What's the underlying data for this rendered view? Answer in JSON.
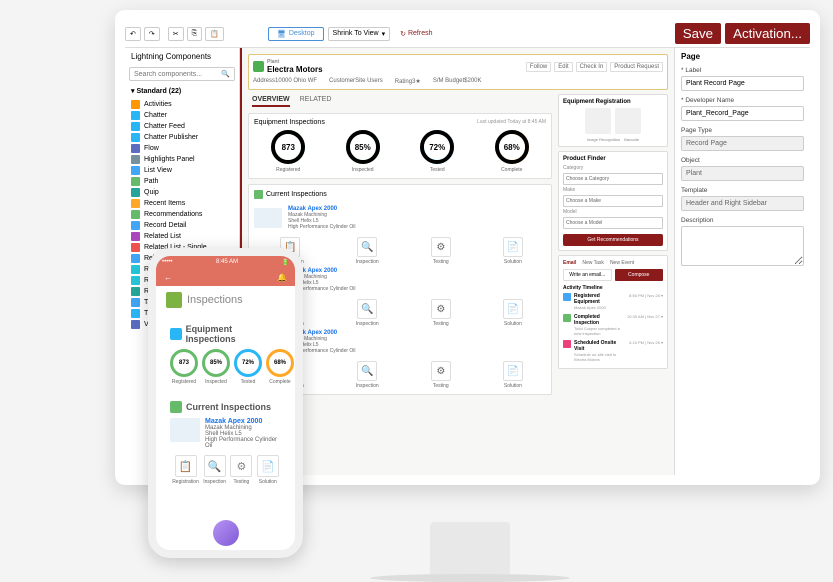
{
  "toolbar": {
    "undo": "↶",
    "desktop": "Desktop",
    "shrink": "Shrink To View",
    "refresh": "Refresh",
    "save": "Save",
    "activation": "Activation..."
  },
  "sidebar": {
    "title": "Lightning Components",
    "search_placeholder": "Search components...",
    "standard_header": "Standard (22)",
    "items": [
      {
        "label": "Activities",
        "color": "#ff9800"
      },
      {
        "label": "Chatter",
        "color": "#29b6f6"
      },
      {
        "label": "Chatter Feed",
        "color": "#29b6f6"
      },
      {
        "label": "Chatter Publisher",
        "color": "#29b6f6"
      },
      {
        "label": "Flow",
        "color": "#5c6bc0"
      },
      {
        "label": "Highlights Panel",
        "color": "#78909c"
      },
      {
        "label": "List View",
        "color": "#42a5f5"
      },
      {
        "label": "Path",
        "color": "#66bb6a"
      },
      {
        "label": "Quip",
        "color": "#26a69a"
      },
      {
        "label": "Recent Items",
        "color": "#ffa726"
      },
      {
        "label": "Recommendations",
        "color": "#66bb6a"
      },
      {
        "label": "Record Detail",
        "color": "#42a5f5"
      },
      {
        "label": "Related List",
        "color": "#ab47bc"
      },
      {
        "label": "Related List - Single",
        "color": "#ef5350"
      },
      {
        "label": "Related Lists",
        "color": "#42a5f5"
      },
      {
        "label": "Related Record",
        "color": "#26c6da"
      },
      {
        "label": "Report Chart",
        "color": "#26c6da"
      },
      {
        "label": "Rich Text",
        "color": "#26a69a"
      },
      {
        "label": "Tabs",
        "color": "#42a5f5"
      },
      {
        "label": "Trending Topics",
        "color": "#29b6f6"
      },
      {
        "label": "Visualforce",
        "color": "#5c6bc0"
      }
    ]
  },
  "page": {
    "type_label": "Plant",
    "title": "Electra Motors",
    "actions": [
      "Follow",
      "Edit",
      "Check In",
      "Product Request"
    ],
    "fields": [
      {
        "label": "Address",
        "value": "10000 Ohio WF"
      },
      {
        "label": "Customer",
        "value": "Site Users"
      },
      {
        "label": "Rating",
        "value": "3★"
      },
      {
        "label": "S/M Budget",
        "value": "$200K"
      }
    ]
  },
  "tabs": [
    "OVERVIEW",
    "RELATED"
  ],
  "equipment_inspections": {
    "title": "Equipment Inspections",
    "updated": "Last updated Today at 8:45 AM",
    "metrics": [
      {
        "value": "873",
        "label": "Registered",
        "color": "#66bb6a"
      },
      {
        "value": "85%",
        "label": "Inspected",
        "color": "#66bb6a"
      },
      {
        "value": "72%",
        "label": "Tested",
        "color": "#29b6f6"
      },
      {
        "value": "68%",
        "label": "Complete",
        "color": "#ffa726"
      }
    ]
  },
  "current_inspections": {
    "title": "Current Inspections",
    "items": [
      {
        "name": "Mazak Apex 2000",
        "sub1": "Mazak Machining",
        "sub2": "Shell Helix L5",
        "sub3": "High Performance Cylinder Oil"
      }
    ],
    "actions": [
      {
        "icon": "📋",
        "label": "Registration"
      },
      {
        "icon": "🔍",
        "label": "Inspection"
      },
      {
        "icon": "⚙",
        "label": "Testing"
      },
      {
        "icon": "📄",
        "label": "Solution"
      }
    ]
  },
  "equipment_registration": {
    "title": "Equipment Registration",
    "img1_label": "Image Recognition",
    "img2_label": "Barcode"
  },
  "product_finder": {
    "title": "Product Finder",
    "category_label": "Category",
    "category_select": "Choose a Category",
    "make_label": "Make",
    "make_select": "Choose a Make",
    "model_label": "Model",
    "model_select": "Choose a Model",
    "button": "Get Recommendations"
  },
  "activity": {
    "tabs": [
      "Email",
      "New Task",
      "New Event"
    ],
    "write_btn": "Write an email...",
    "compose_btn": "Compose",
    "timeline_title": "Activity Timeline",
    "items": [
      {
        "title": "Registered Equipment",
        "sub": "Mazak Apex 2000",
        "time": "8:56 PM | Nov 28",
        "color": "#42a5f5"
      },
      {
        "title": "Completed Inspection",
        "sub": "Todd Cooper completed a new inspection",
        "time": "10:30 AM | Nov 27",
        "color": "#66bb6a"
      },
      {
        "title": "Scheduled Onsite Visit",
        "sub": "Schedule on-site visit to Electra Motors",
        "time": "3:15 PM | Nov 26",
        "color": "#ec407a"
      }
    ]
  },
  "properties": {
    "title": "Page",
    "label_label": "* Label",
    "label_value": "Plant Record Page",
    "devname_label": "* Developer Name",
    "devname_value": "Plant_Record_Page",
    "pagetype_label": "Page Type",
    "pagetype_value": "Record Page",
    "object_label": "Object",
    "object_value": "Plant",
    "template_label": "Template",
    "template_value": "Header and Right Sidebar",
    "description_label": "Description"
  },
  "phone": {
    "time": "8:45 AM",
    "back": "←",
    "bell": "🔔",
    "title": "Inspections",
    "equip_title": "Equipment Inspections",
    "metrics": [
      {
        "value": "873",
        "label": "Registered",
        "color": "#66bb6a"
      },
      {
        "value": "85%",
        "label": "Inspected",
        "color": "#66bb6a"
      },
      {
        "value": "72%",
        "label": "Tested",
        "color": "#29b6f6"
      },
      {
        "value": "68%",
        "label": "Complete",
        "color": "#ffa726"
      }
    ],
    "current_title": "Current Inspections",
    "insp": {
      "name": "Mazak Apex 2000",
      "sub1": "Mazak Machining",
      "sub2": "Shell Helix L5",
      "sub3": "High Performance Cylinder Oil"
    },
    "actions": [
      {
        "icon": "📋",
        "label": "Registration"
      },
      {
        "icon": "🔍",
        "label": "Inspection"
      },
      {
        "icon": "⚙",
        "label": "Testing"
      },
      {
        "icon": "📄",
        "label": "Solution"
      }
    ]
  }
}
